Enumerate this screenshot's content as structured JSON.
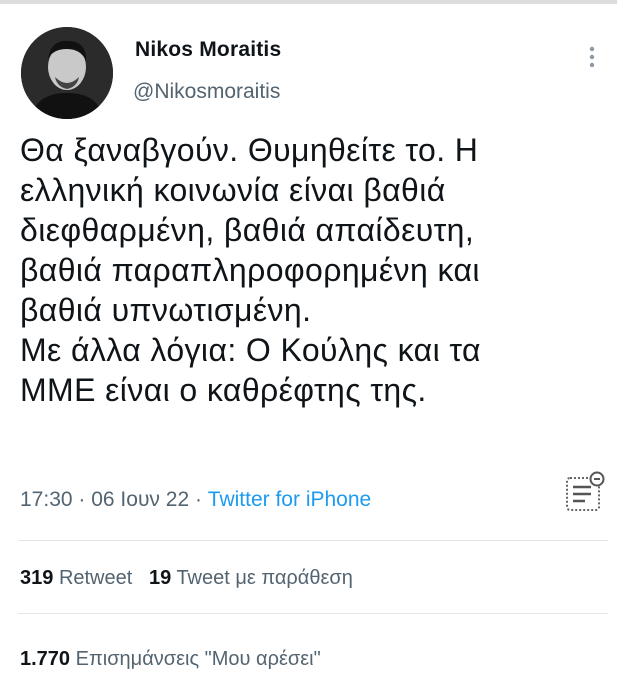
{
  "author": {
    "name": "Nikos Moraitis",
    "handle": "@Nikosmoraitis"
  },
  "tweet": {
    "lines": [
      "Θα ξαναβγούν. Θυμηθείτε το. Η",
      "ελληνική κοινωνία είναι βαθιά",
      "διεφθαρμένη, βαθιά απαίδευτη,",
      "βαθιά παραπληροφορημένη και",
      "βαθιά υπνωτισμένη.",
      "Με άλλα λόγια: Ο Κούλης και τα",
      "ΜΜΕ είναι ο καθρέφτης της."
    ],
    "time": "17:30",
    "date": "06 Ιουν 22",
    "separator": " · ",
    "source": "Twitter for iPhone"
  },
  "stats": {
    "retweets_count": "319",
    "retweets_label": "Retweet",
    "quotes_count": "19",
    "quotes_label": "Tweet με παράθεση",
    "likes_count": "1.770",
    "likes_label": "Επισημάνσεις \"Μου αρέσει\""
  },
  "icons": {
    "more": "more-vertical-icon",
    "notes": "note-icon"
  },
  "colors": {
    "text": "#0f1419",
    "secondary": "#536471",
    "link": "#1d9bf0",
    "divider": "#e1e6ea"
  }
}
